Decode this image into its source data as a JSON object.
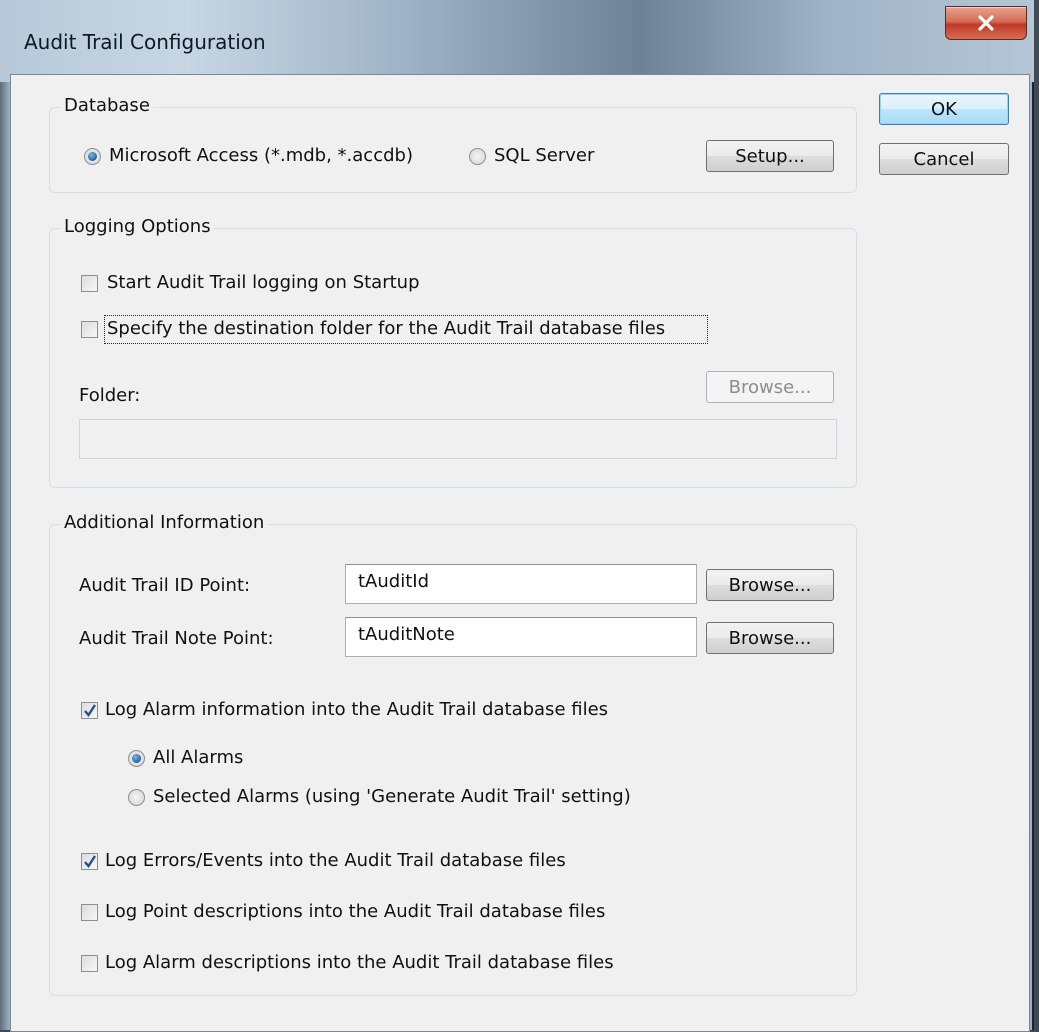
{
  "window": {
    "title": "Audit Trail Configuration",
    "close_label": "X"
  },
  "buttons": {
    "ok": "OK",
    "cancel": "Cancel"
  },
  "database": {
    "title": "Database",
    "options": [
      {
        "label": "Microsoft Access (*.mdb, *.accdb)",
        "selected": true
      },
      {
        "label": "SQL Server",
        "selected": false
      }
    ],
    "setup_label": "Setup..."
  },
  "logging": {
    "title": "Logging Options",
    "start_on_startup": {
      "label": "Start Audit Trail logging on Startup",
      "checked": false
    },
    "specify_folder": {
      "label": "Specify the destination folder for the Audit Trail database files",
      "checked": false
    },
    "folder_label": "Folder:",
    "browse_label": "Browse...",
    "folder_value": ""
  },
  "additional": {
    "title": "Additional Information",
    "id_point": {
      "label": "Audit Trail ID Point:",
      "value": "tAuditId",
      "browse_label": "Browse..."
    },
    "note_point": {
      "label": "Audit Trail Note Point:",
      "value": "tAuditNote",
      "browse_label": "Browse..."
    },
    "log_alarm": {
      "label": "Log Alarm information into the Audit Trail database files",
      "checked": true
    },
    "alarm_options": [
      {
        "label": "All Alarms",
        "selected": true
      },
      {
        "label": "Selected Alarms (using 'Generate Audit Trail' setting)",
        "selected": false
      }
    ],
    "log_errors": {
      "label": "Log Errors/Events into the Audit Trail database files",
      "checked": true
    },
    "log_point_desc": {
      "label": "Log Point descriptions into the Audit Trail database files",
      "checked": false
    },
    "log_alarm_desc": {
      "label": "Log Alarm descriptions into the Audit Trail database files",
      "checked": false
    }
  },
  "colors": {
    "accent": "#1c5a9c",
    "close_button": "#c0392b",
    "dialog_background": "#f0f0f0"
  }
}
